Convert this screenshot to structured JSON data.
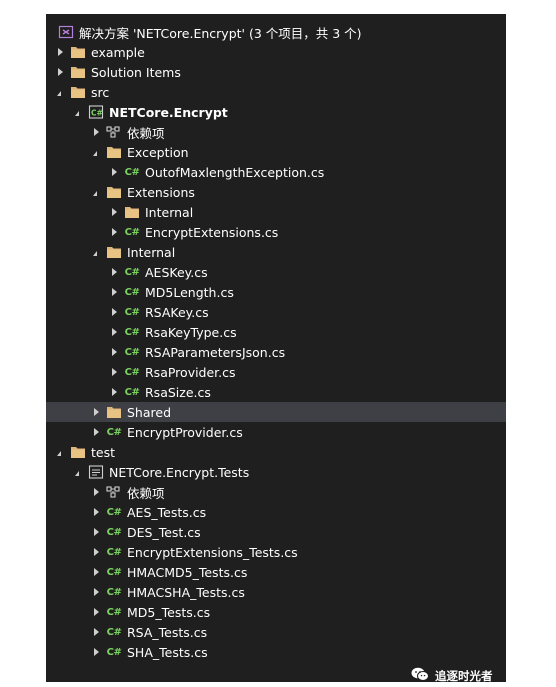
{
  "solution": {
    "label": "解决方案 'NETCore.Encrypt' (3 个项目，共 3 个)",
    "icon": "solution-icon"
  },
  "tree": [
    {
      "label": "example",
      "icon": "folder-icon",
      "state": "collapsed"
    },
    {
      "label": "Solution Items",
      "icon": "folder-icon",
      "state": "collapsed"
    },
    {
      "label": "src",
      "icon": "folder-icon",
      "state": "expanded"
    },
    {
      "label": "NETCore.Encrypt",
      "icon": "csharp-project-icon",
      "state": "expanded",
      "bold": true
    },
    {
      "label": "依赖项",
      "icon": "dependencies-icon",
      "state": "collapsed"
    },
    {
      "label": "Exception",
      "icon": "folder-icon",
      "state": "expanded"
    },
    {
      "label": "OutofMaxlengthException.cs",
      "icon": "csharp-file-icon",
      "state": "collapsed"
    },
    {
      "label": "Extensions",
      "icon": "folder-icon",
      "state": "expanded"
    },
    {
      "label": "Internal",
      "icon": "folder-icon",
      "state": "collapsed"
    },
    {
      "label": "EncryptExtensions.cs",
      "icon": "csharp-file-icon",
      "state": "collapsed"
    },
    {
      "label": "Internal",
      "icon": "folder-icon",
      "state": "expanded"
    },
    {
      "label": "AESKey.cs",
      "icon": "csharp-file-icon",
      "state": "collapsed"
    },
    {
      "label": "MD5Length.cs",
      "icon": "csharp-file-icon",
      "state": "collapsed"
    },
    {
      "label": "RSAKey.cs",
      "icon": "csharp-file-icon",
      "state": "collapsed"
    },
    {
      "label": "RsaKeyType.cs",
      "icon": "csharp-file-icon",
      "state": "collapsed"
    },
    {
      "label": "RSAParametersJson.cs",
      "icon": "csharp-file-icon",
      "state": "collapsed"
    },
    {
      "label": "RsaProvider.cs",
      "icon": "csharp-file-icon",
      "state": "collapsed"
    },
    {
      "label": "RsaSize.cs",
      "icon": "csharp-file-icon",
      "state": "collapsed"
    },
    {
      "label": "Shared",
      "icon": "folder-icon",
      "state": "collapsed",
      "selected": true
    },
    {
      "label": "EncryptProvider.cs",
      "icon": "csharp-file-icon",
      "state": "collapsed"
    },
    {
      "label": "test",
      "icon": "folder-icon",
      "state": "expanded"
    },
    {
      "label": "NETCore.Encrypt.Tests",
      "icon": "test-project-icon",
      "state": "expanded"
    },
    {
      "label": "依赖项",
      "icon": "dependencies-icon",
      "state": "collapsed"
    },
    {
      "label": "AES_Tests.cs",
      "icon": "csharp-file-icon",
      "state": "collapsed"
    },
    {
      "label": "DES_Test.cs",
      "icon": "csharp-file-icon",
      "state": "collapsed"
    },
    {
      "label": "EncryptExtensions_Tests.cs",
      "icon": "csharp-file-icon",
      "state": "collapsed"
    },
    {
      "label": "HMACMD5_Tests.cs",
      "icon": "csharp-file-icon",
      "state": "collapsed"
    },
    {
      "label": "HMACSHA_Tests.cs",
      "icon": "csharp-file-icon",
      "state": "collapsed"
    },
    {
      "label": "MD5_Tests.cs",
      "icon": "csharp-file-icon",
      "state": "collapsed"
    },
    {
      "label": "RSA_Tests.cs",
      "icon": "csharp-file-icon",
      "state": "collapsed"
    },
    {
      "label": "SHA_Tests.cs",
      "icon": "csharp-file-icon",
      "state": "collapsed"
    }
  ],
  "icons": {
    "csharp_glyph": "C#"
  },
  "watermark": {
    "label": "追逐时光者",
    "icon": "wechat-icon"
  },
  "colors": {
    "panel_bg": "#1f1f1f",
    "selected_bg": "#3f3f46",
    "csharp": "#7bd35f",
    "folder": "#dcb67a",
    "solution": "#b180d7"
  }
}
